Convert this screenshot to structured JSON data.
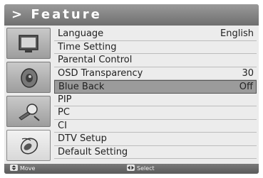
{
  "title": "> Feature",
  "icons": [
    "picture-icon",
    "sound-icon",
    "setup-icon",
    "feature-icon"
  ],
  "menu": [
    {
      "label": "Language",
      "value": "English"
    },
    {
      "label": "Time Setting",
      "value": ""
    },
    {
      "label": "Parental Control",
      "value": ""
    },
    {
      "label": "OSD Transparency",
      "value": "30"
    },
    {
      "label": "Blue Back",
      "value": "Off",
      "selected": true
    },
    {
      "label": "PIP",
      "value": ""
    },
    {
      "label": "PC",
      "value": ""
    },
    {
      "label": "CI",
      "value": ""
    },
    {
      "label": "DTV Setup",
      "value": ""
    },
    {
      "label": "Default Setting",
      "value": ""
    }
  ],
  "footer": {
    "move_label": "Move",
    "select_label": "Select"
  }
}
